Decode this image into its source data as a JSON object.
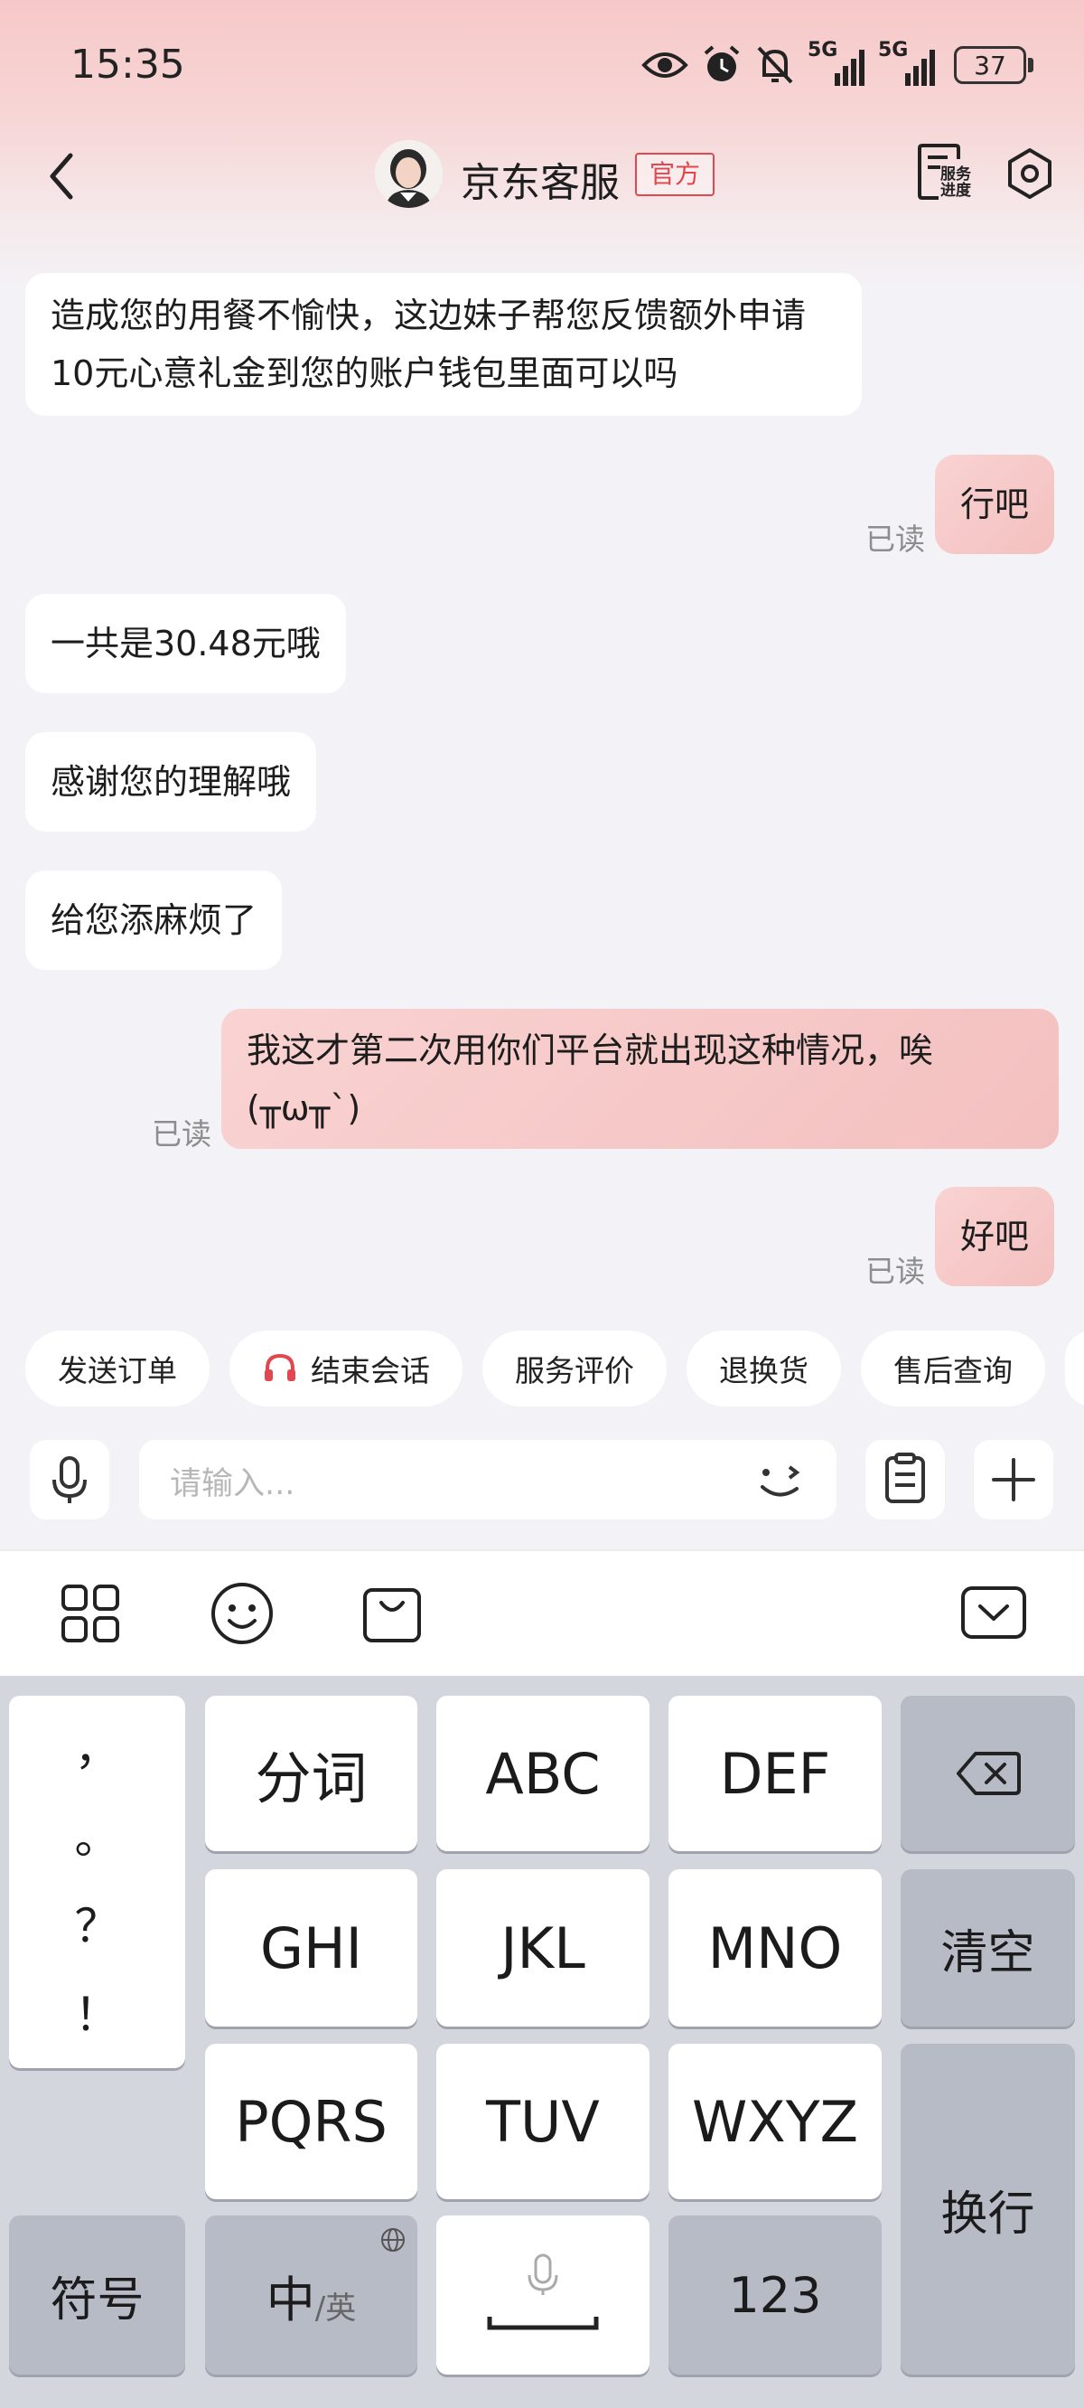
{
  "status_bar": {
    "time": "15:35",
    "battery": "37",
    "signal_1": "5G",
    "signal_2": "5G"
  },
  "header": {
    "title": "京东客服",
    "badge": "官方",
    "service_progress_label": "服务\n进度"
  },
  "messages": [
    {
      "side": "in",
      "text": "造成您的用餐不愉快，这边妹子帮您反馈额外申请10元心意礼金到您的账户钱包里面可以吗"
    },
    {
      "side": "out",
      "text": "行吧",
      "read": "已读"
    },
    {
      "side": "in",
      "text": "一共是30.48元哦"
    },
    {
      "side": "in",
      "text": "感谢您的理解哦"
    },
    {
      "side": "in",
      "text": "给您添麻烦了"
    },
    {
      "side": "out",
      "text": "我这才第二次用你们平台就出现这种情况，唉(╥ω╥`)",
      "read": "已读"
    },
    {
      "side": "out",
      "text": "好吧",
      "read": "已读"
    }
  ],
  "quick_actions": [
    "发送订单",
    "结束会话",
    "服务评价",
    "退换货",
    "售后查询"
  ],
  "input": {
    "placeholder": "请输入..."
  },
  "keyboard": {
    "punct": [
      "，",
      "。",
      "？",
      "！"
    ],
    "row1": [
      "分词",
      "ABC",
      "DEF"
    ],
    "row2": [
      "GHI",
      "JKL",
      "MNO"
    ],
    "row3": [
      "PQRS",
      "TUV",
      "WXYZ"
    ],
    "clear": "清空",
    "enter": "换行",
    "symbols": "符号",
    "lang_main": "中",
    "lang_alt": "/英",
    "numbers": "123"
  },
  "colors": {
    "accent": "#e0474f",
    "outgoing_bubble": "#f6c6c5",
    "keyboard_bg": "#d3d6dd"
  }
}
